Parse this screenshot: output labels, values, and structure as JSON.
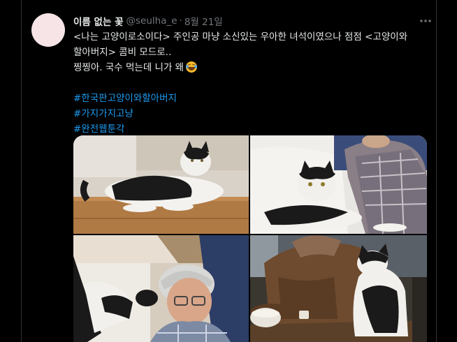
{
  "tweet": {
    "display_name": "이름 없는 꽃",
    "handle": "@seulha_e",
    "separator": "·",
    "date": "8월 21일",
    "text_lines": [
      "<나는 고양이로소이다> 주인공 마냥 소신있는 우아한 녀석이였으나 점점  <고양이와",
      "할아버지> 콤비 모드로..",
      "찡찡아. 국수 먹는데 니가 왜"
    ],
    "emoji": "rolling-on-floor-laughing",
    "hashtags": [
      "#한국판고양이와할아버지",
      "#가지가지고냥",
      "#완전웹툰각"
    ],
    "media_count": 4
  },
  "colors": {
    "background": "#000000",
    "text": "#e7e9ea",
    "secondary_text": "#71767b",
    "link": "#1d9bf0",
    "border": "#2f3336",
    "avatar": "#f7e4e6"
  },
  "icons": {
    "more": "more-horizontal-icon"
  }
}
